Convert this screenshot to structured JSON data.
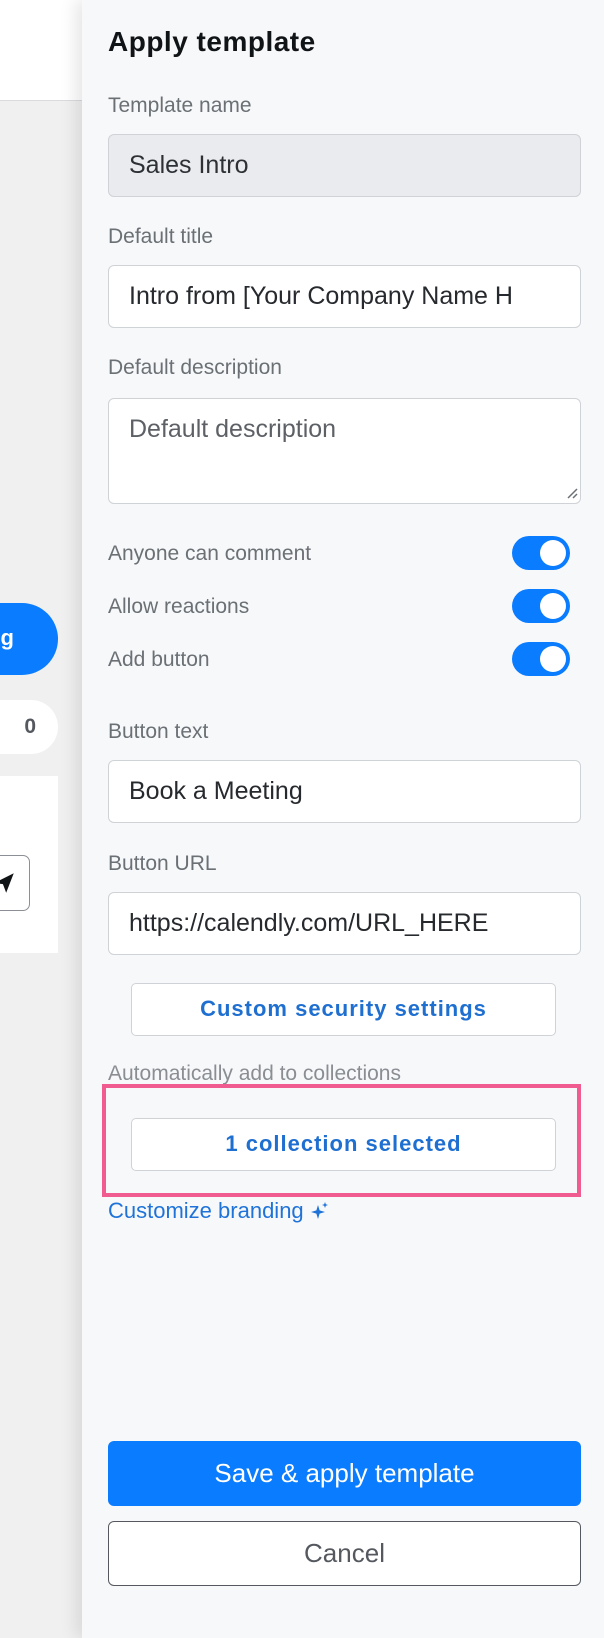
{
  "background": {
    "pill_blue_text": "g",
    "pill_count": "0"
  },
  "panel": {
    "title": "Apply template",
    "template_name": {
      "label": "Template name",
      "value": "Sales Intro"
    },
    "default_title": {
      "label": "Default title",
      "value": "Intro from [Your Company Name H"
    },
    "default_description": {
      "label": "Default description",
      "placeholder": "Default description"
    },
    "toggles": [
      {
        "label": "Anyone can comment",
        "on": true
      },
      {
        "label": "Allow reactions",
        "on": true
      },
      {
        "label": "Add button",
        "on": true
      }
    ],
    "button_text": {
      "label": "Button text",
      "value": "Book a Meeting"
    },
    "button_url": {
      "label": "Button URL",
      "value": "https://calendly.com/URL_HERE"
    },
    "security_button": "Custom security settings",
    "collections": {
      "label": "Automatically add to collections",
      "button": "1 collection selected"
    },
    "branding_link": "Customize branding",
    "save_button": "Save & apply template",
    "cancel_button": "Cancel"
  },
  "colors": {
    "accent": "#0a7cff",
    "link": "#1f73d8",
    "highlight": "#f05c8f"
  },
  "icons": [
    "send-icon",
    "sparkle-icon",
    "resize-grip-icon"
  ]
}
